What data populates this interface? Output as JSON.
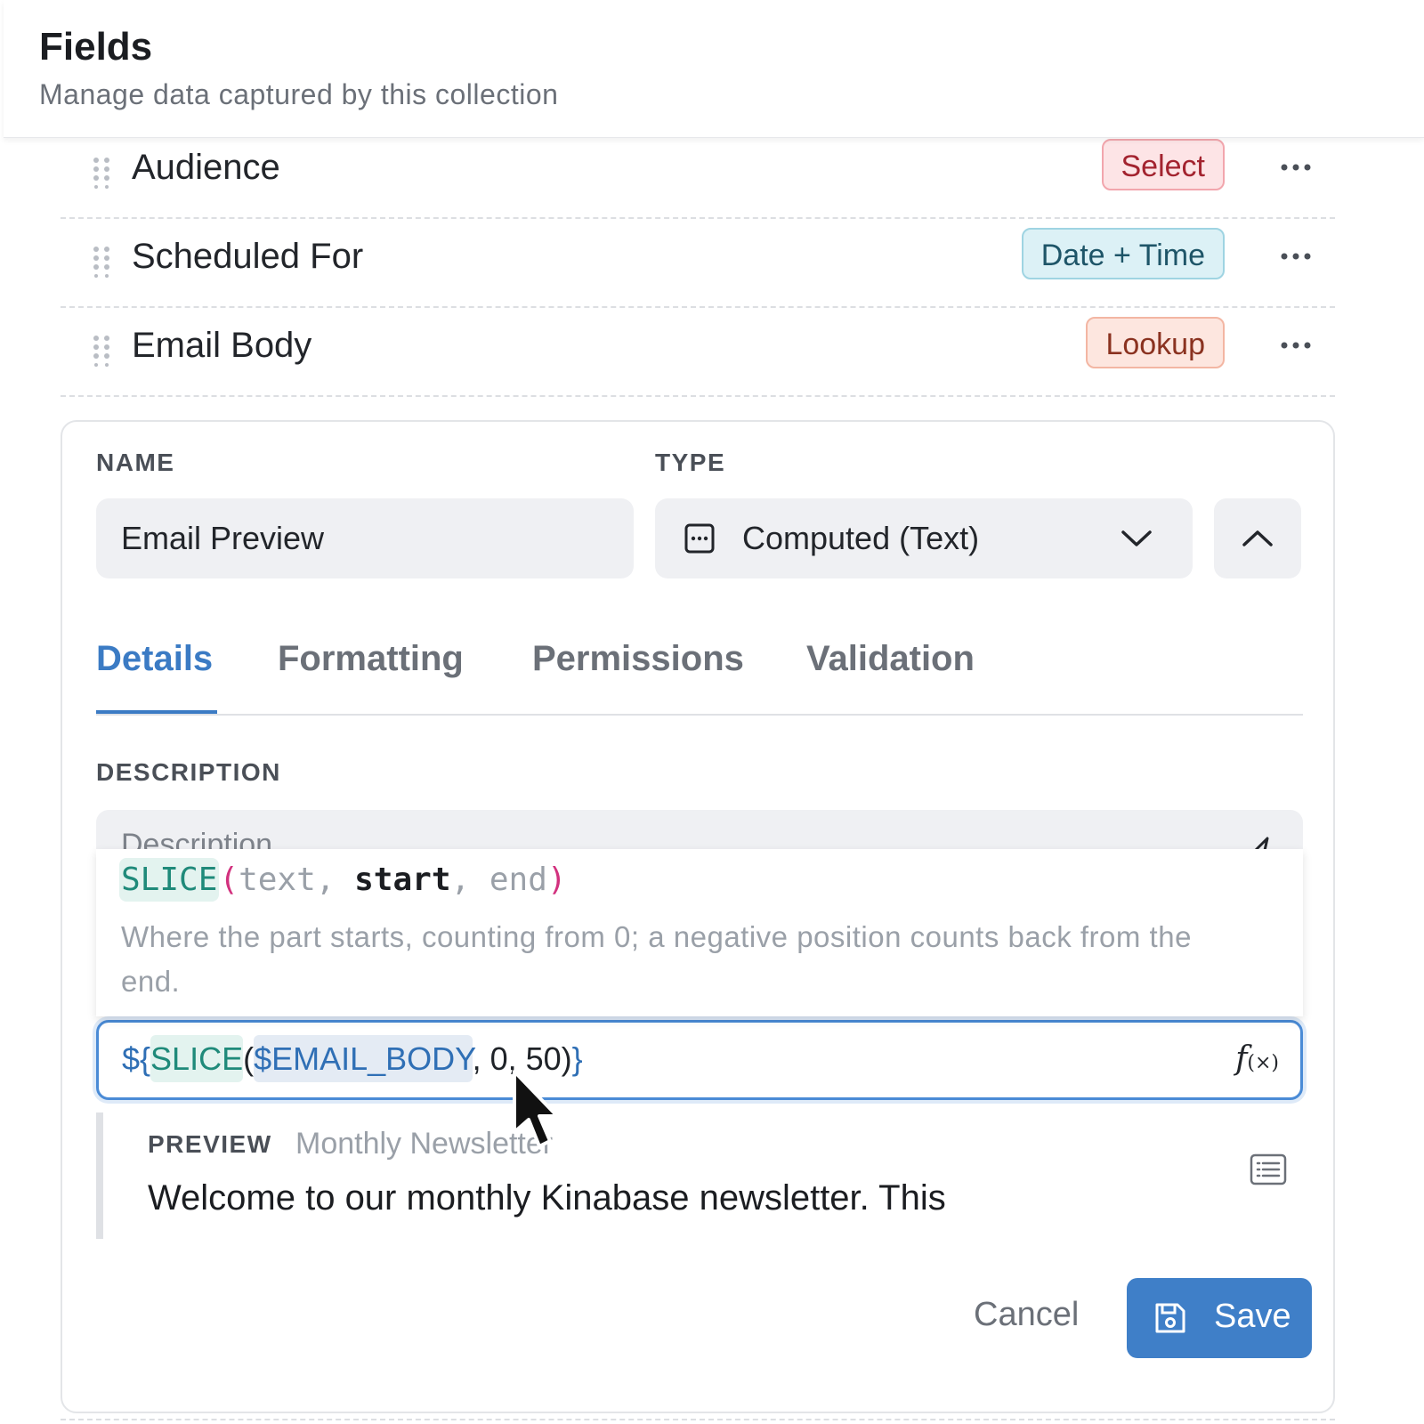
{
  "header": {
    "title": "Fields",
    "subtitle": "Manage data captured by this collection"
  },
  "fields": [
    {
      "name": "Audience",
      "type": "Select",
      "type_color": "#fde4e6",
      "drag_icon": "drag-handle-icon",
      "menu_icon": "more-horizontal-icon"
    },
    {
      "name": "Scheduled For",
      "type": "Date + Time",
      "type_color": "#dcf1f6",
      "drag_icon": "drag-handle-icon",
      "menu_icon": "more-horizontal-icon"
    },
    {
      "name": "Email Body",
      "type": "Lookup",
      "type_color": "#fde6df",
      "drag_icon": "drag-handle-icon",
      "menu_icon": "more-horizontal-icon"
    }
  ],
  "editor": {
    "name_label": "NAME",
    "name_value": "Email Preview",
    "type_label": "TYPE",
    "type_value": "Computed (Text)",
    "type_icon": "computed-field-icon",
    "tabs": [
      {
        "label": "Details",
        "active": true
      },
      {
        "label": "Formatting",
        "active": false
      },
      {
        "label": "Permissions",
        "active": false
      },
      {
        "label": "Validation",
        "active": false
      }
    ],
    "description_label": "DESCRIPTION",
    "description_placeholder": "Description",
    "autocomplete": {
      "function": "SLICE",
      "open_paren": "(",
      "params": [
        "text",
        "start",
        "end"
      ],
      "active_param": "start",
      "close_paren": ")",
      "hint": "Where the part starts, counting from 0; a negative position counts back from the end."
    },
    "formula": {
      "prefix": "${",
      "function": "SLICE",
      "open": "(",
      "variable": "$EMAIL_BODY",
      "rest": ", 0, 50)",
      "suffix": "}",
      "icon": "fx-icon"
    },
    "preview": {
      "label": "PREVIEW",
      "source": "Monthly Newsletter",
      "text": "Welcome to our monthly Kinabase newsletter. This",
      "icon": "list-view-icon"
    },
    "cancel_label": "Cancel",
    "save_label": "Save"
  },
  "colors": {
    "accent": "#3f7fc8",
    "tab_active": "#3b7bc4",
    "function_teal": "#1f8a7a",
    "paren_pink": "#d2317e"
  }
}
